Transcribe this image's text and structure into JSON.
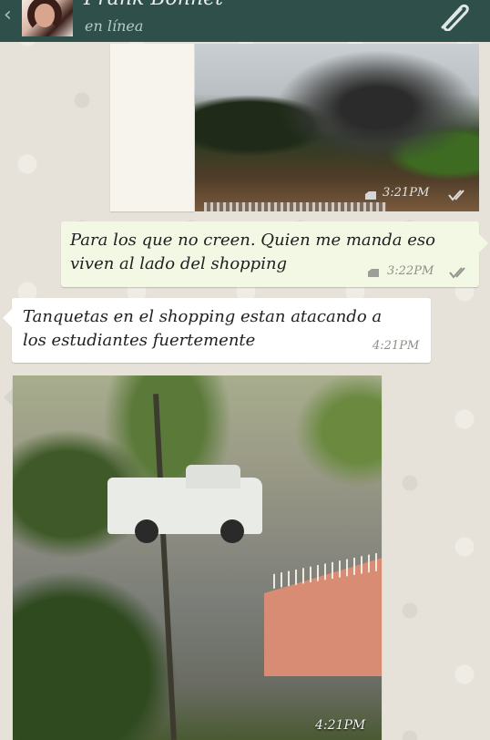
{
  "header": {
    "back_icon": "chevron-left-icon",
    "contact_name": "Frank Bonnet",
    "status": "en línea",
    "attach_icon": "paperclip-icon",
    "color": "#2f4f4a"
  },
  "messages": [
    {
      "type": "image",
      "direction": "outgoing",
      "time": "3:21PM",
      "status_icon": "double-check-icon"
    },
    {
      "type": "text",
      "direction": "outgoing",
      "lines": [
        "Para los que no creen. Quien me manda eso",
        "viven  al lado del shopping"
      ],
      "time": "3:22PM",
      "status_icon": "double-check-icon"
    },
    {
      "type": "text",
      "direction": "incoming",
      "lines": [
        "Tanquetas en el shopping estan atacando a",
        "los estudiantes fuertemente"
      ],
      "time": "4:21PM"
    },
    {
      "type": "image",
      "direction": "incoming",
      "time": "4:21PM"
    }
  ],
  "colors": {
    "outgoing_bubble": "#f2f8e3",
    "incoming_bubble": "#ffffff",
    "wallpaper": "#e7e2d9"
  }
}
